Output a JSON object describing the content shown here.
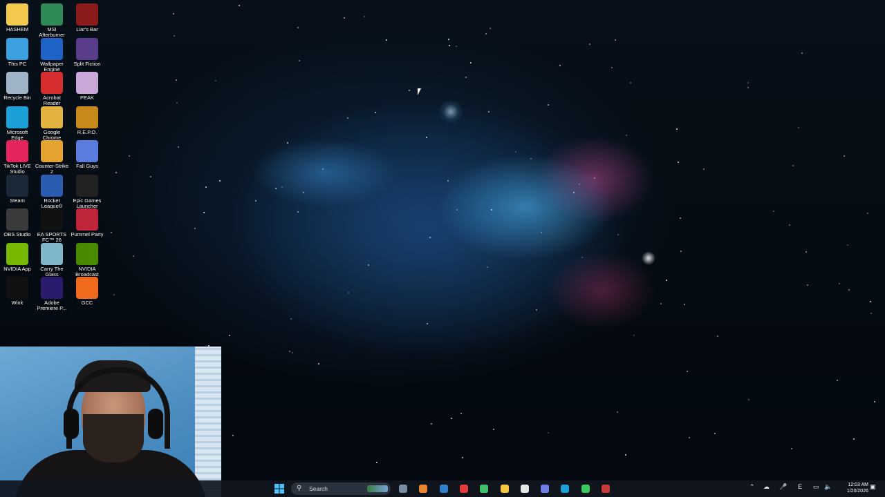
{
  "desktop": {
    "icons": [
      {
        "label": "HASHEM",
        "icon": "folder-icon",
        "color": "#f2c94c"
      },
      {
        "label": "MSI Afterburner",
        "icon": "msi-afterburner-icon",
        "color": "#2e8b57"
      },
      {
        "label": "Liar's Bar",
        "icon": "liars-bar-icon",
        "color": "#8b1a1a"
      },
      {
        "label": "This PC",
        "icon": "this-pc-icon",
        "color": "#3aa0e0"
      },
      {
        "label": "Wallpaper Engine",
        "icon": "wallpaper-engine-icon",
        "color": "#1e63c6"
      },
      {
        "label": "Split Fiction",
        "icon": "split-fiction-icon",
        "color": "#5a3d8a"
      },
      {
        "label": "Recycle Bin",
        "icon": "recycle-bin-icon",
        "color": "#9fb4c6"
      },
      {
        "label": "Acrobat Reader",
        "icon": "acrobat-reader-icon",
        "color": "#d62e2e"
      },
      {
        "label": "PEAK",
        "icon": "peak-icon",
        "color": "#c9a7d8"
      },
      {
        "label": "Microsoft Edge",
        "icon": "edge-icon",
        "color": "#1ba0d8"
      },
      {
        "label": "Google Chrome",
        "icon": "chrome-icon",
        "color": "#e3b341"
      },
      {
        "label": "R.E.P.O.",
        "icon": "repo-icon",
        "color": "#c78a1a"
      },
      {
        "label": "TikTok LIVE Studio",
        "icon": "tiktok-live-icon",
        "color": "#e4245a"
      },
      {
        "label": "Counter-Strike 2",
        "icon": "counter-strike-icon",
        "color": "#e3a32e"
      },
      {
        "label": "Fall Guys",
        "icon": "fall-guys-icon",
        "color": "#5b7de0"
      },
      {
        "label": "Steam",
        "icon": "steam-icon",
        "color": "#1b2838"
      },
      {
        "label": "Rocket League®",
        "icon": "rocket-league-icon",
        "color": "#2a5db0"
      },
      {
        "label": "Epic Games Launcher",
        "icon": "epic-games-icon",
        "color": "#222222"
      },
      {
        "label": "OBS Studio",
        "icon": "obs-icon",
        "color": "#3b3b3b"
      },
      {
        "label": "EA SPORTS FC™ 26",
        "icon": "ea-sports-fc-icon",
        "color": "#111111"
      },
      {
        "label": "Pummel Party",
        "icon": "pummel-party-icon",
        "color": "#c0263a"
      },
      {
        "label": "NVIDIA App",
        "icon": "nvidia-app-icon",
        "color": "#76b900"
      },
      {
        "label": "Carry The Glass",
        "icon": "carry-the-glass-icon",
        "color": "#7fb6c9"
      },
      {
        "label": "NVIDIA Broadcast",
        "icon": "nvidia-broadcast-icon",
        "color": "#4a8a00"
      },
      {
        "label": "Wink",
        "icon": "wink-icon",
        "color": "#111111"
      },
      {
        "label": "Adobe Premiere P...",
        "icon": "premiere-pro-icon",
        "color": "#2a1b6e"
      },
      {
        "label": "GCC",
        "icon": "gcc-icon",
        "color": "#f06a1d"
      }
    ]
  },
  "taskbar": {
    "search_label": "Search",
    "clock": {
      "time": "12:03 AM",
      "date": "1/20/2026"
    },
    "tray_language": "E",
    "pinned": [
      "windows-start-icon",
      "widgets-icon",
      "settings-icon",
      "cloud-app-icon",
      "store-icon",
      "record-app-icon",
      "xbox-icon",
      "file-explorer-icon",
      "chrome-icon",
      "discord-icon",
      "edge-icon",
      "launcher-icon",
      "game-app-icon"
    ]
  }
}
